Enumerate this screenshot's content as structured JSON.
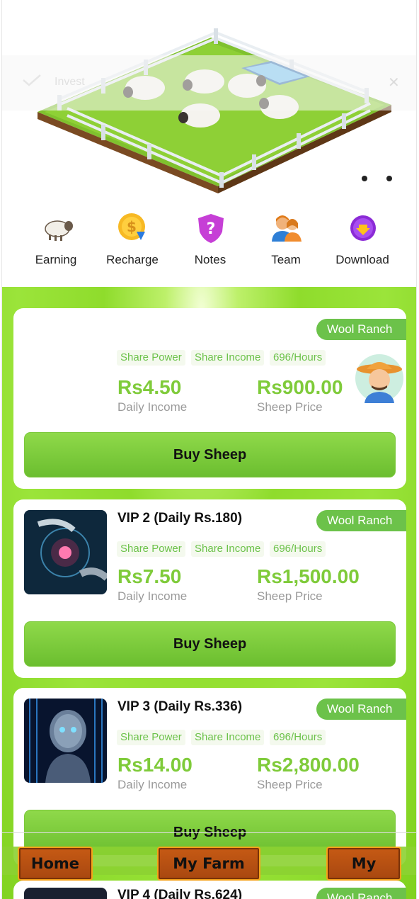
{
  "toast": {
    "text": "Invest"
  },
  "quick_menu": [
    {
      "label": "Earning",
      "icon": "sheep-icon"
    },
    {
      "label": "Recharge",
      "icon": "coin-icon"
    },
    {
      "label": "Notes",
      "icon": "shield-question-icon"
    },
    {
      "label": "Team",
      "icon": "team-icon"
    },
    {
      "label": "Download",
      "icon": "download-icon"
    }
  ],
  "cards": [
    {
      "title": "",
      "badge": "Wool Ranch",
      "tags": [
        "Share Power",
        "Share Income",
        "696/Hours"
      ],
      "daily_income": "Rs4.50",
      "daily_income_label": "Daily Income",
      "price": "Rs900.00",
      "price_label": "Sheep Price",
      "button": "Buy Sheep"
    },
    {
      "title": "VIP 2 (Daily Rs.180)",
      "badge": "Wool Ranch",
      "tags": [
        "Share Power",
        "Share Income",
        "696/Hours"
      ],
      "daily_income": "Rs7.50",
      "daily_income_label": "Daily Income",
      "price": "Rs1,500.00",
      "price_label": "Sheep Price",
      "button": "Buy Sheep"
    },
    {
      "title": "VIP 3 (Daily Rs.336)",
      "badge": "Wool Ranch",
      "tags": [
        "Share Power",
        "Share Income",
        "696/Hours"
      ],
      "daily_income": "Rs14.00",
      "daily_income_label": "Daily Income",
      "price": "Rs2,800.00",
      "price_label": "Sheep Price",
      "button": "Buy Sheep"
    },
    {
      "title": "VIP 4 (Daily Rs.624)",
      "badge": "Wool Ranch"
    }
  ],
  "nav": {
    "home": "Home",
    "farm": "My Farm",
    "my": "My"
  },
  "colors": {
    "accent": "#6cc24a",
    "amount": "#7fcb3a",
    "nav_wood": "#b84f12"
  }
}
